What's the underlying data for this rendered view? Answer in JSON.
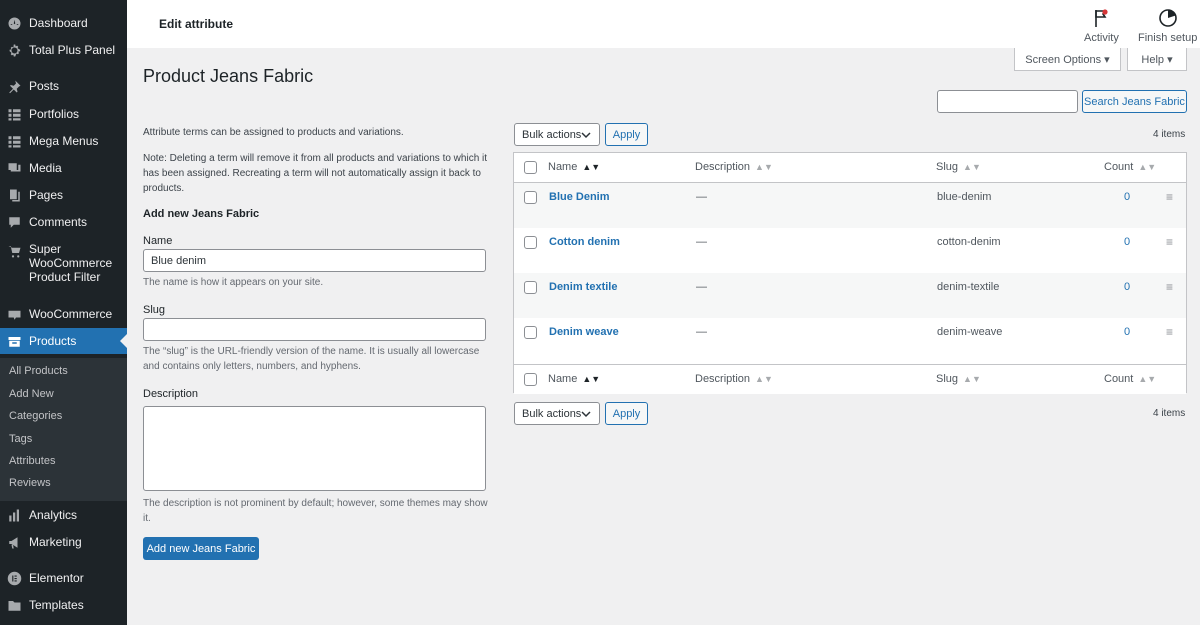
{
  "sidebar": {
    "items": [
      {
        "label": "Dashboard",
        "icon": "dashboard-icon"
      },
      {
        "label": "Total Plus Panel",
        "icon": "gear-icon"
      },
      {
        "label": "Posts",
        "icon": "pin-icon"
      },
      {
        "label": "Portfolios",
        "icon": "grid-icon"
      },
      {
        "label": "Mega Menus",
        "icon": "grid-icon"
      },
      {
        "label": "Media",
        "icon": "media-icon"
      },
      {
        "label": "Pages",
        "icon": "page-icon"
      },
      {
        "label": "Comments",
        "icon": "comment-icon"
      },
      {
        "label": "Super WooCommerce Product Filter",
        "icon": "cart-icon"
      },
      {
        "label": "WooCommerce",
        "icon": "woo-icon"
      },
      {
        "label": "Products",
        "icon": "archive-icon"
      },
      {
        "label": "Analytics",
        "icon": "chart-bar-icon"
      },
      {
        "label": "Marketing",
        "icon": "megaphone-icon"
      },
      {
        "label": "Elementor",
        "icon": "elementor-icon"
      },
      {
        "label": "Templates",
        "icon": "folder-icon"
      }
    ],
    "submenu": [
      "All Products",
      "Add New",
      "Categories",
      "Tags",
      "Attributes",
      "Reviews"
    ]
  },
  "topbar": {
    "title": "Edit attribute",
    "activity": "Activity",
    "finish_setup": "Finish setup"
  },
  "screen_options": "Screen Options ▾",
  "help": "Help ▾",
  "page_title": "Product Jeans Fabric",
  "search": {
    "button": "Search Jeans Fabric",
    "value": ""
  },
  "form": {
    "intro": "Attribute terms can be assigned to products and variations.",
    "note": "Note: Deleting a term will remove it from all products and variations to which it has been assigned. Recreating a term will not automatically assign it back to products.",
    "heading": "Add new Jeans Fabric",
    "name_label": "Name",
    "name_value": "Blue denim",
    "name_hint": "The name is how it appears on your site.",
    "slug_label": "Slug",
    "slug_value": "",
    "slug_hint": "The “slug” is the URL-friendly version of the name. It is usually all lowercase and contains only letters, numbers, and hyphens.",
    "description_label": "Description",
    "description_hint": "The description is not prominent by default; however, some themes may show it.",
    "submit": "Add new Jeans Fabric"
  },
  "bulk": {
    "label": "Bulk actions",
    "apply": "Apply",
    "count": "4 items"
  },
  "table": {
    "columns": {
      "name": "Name",
      "description": "Description",
      "slug": "Slug",
      "count": "Count"
    },
    "rows": [
      {
        "name": "Blue Denim",
        "description": "—",
        "slug": "blue-denim",
        "count": "0"
      },
      {
        "name": "Cotton denim",
        "description": "—",
        "slug": "cotton-denim",
        "count": "0"
      },
      {
        "name": "Denim textile",
        "description": "—",
        "slug": "denim-textile",
        "count": "0"
      },
      {
        "name": "Denim weave",
        "description": "—",
        "slug": "denim-weave",
        "count": "0"
      }
    ]
  },
  "colors": {
    "sidebar_bg": "#1d2327",
    "accent": "#2271b1",
    "page_bg": "#f0f0f1"
  }
}
